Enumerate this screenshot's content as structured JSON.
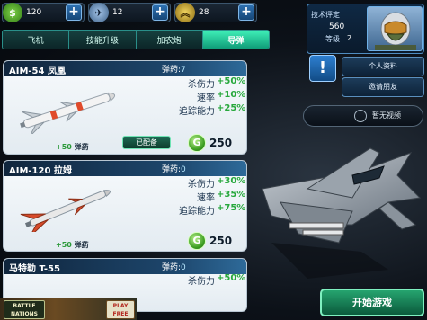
{
  "resources": {
    "gold": "120",
    "wings": "12",
    "rank": "28"
  },
  "tabs": [
    "飞机",
    "技能升级",
    "加农炮",
    "导弹"
  ],
  "active_tab": "导弹",
  "weapons": [
    {
      "name": "AIM-54 凤凰",
      "ammo_label": "弹药:",
      "ammo": "7",
      "stats": [
        {
          "label": "杀伤力",
          "value": "+50%"
        },
        {
          "label": "速率",
          "value": "+10%"
        },
        {
          "label": "追踪能力",
          "value": "+25%"
        }
      ],
      "buy_ammo": "+50",
      "buy_ammo_label": "弹药",
      "status": "已配备",
      "price": "250"
    },
    {
      "name": "AIM-120 拉姆",
      "ammo_label": "弹药:",
      "ammo": "0",
      "stats": [
        {
          "label": "杀伤力",
          "value": "+30%"
        },
        {
          "label": "速率",
          "value": "+35%"
        },
        {
          "label": "追踪能力",
          "value": "+75%"
        }
      ],
      "buy_ammo": "+50",
      "buy_ammo_label": "弹药",
      "price": "250"
    },
    {
      "name": "马特勒 T-55",
      "ammo_label": "弹药:",
      "ammo": "0",
      "stats": [
        {
          "label": "杀伤力",
          "value": "+50%"
        }
      ]
    }
  ],
  "profile": {
    "skill_label": "技术评定",
    "score": "560",
    "level_label": "等级",
    "level": "2"
  },
  "buttons": {
    "alert": "!",
    "personal_info": "个人资料",
    "invite_friends": "邀请朋友",
    "no_video": "暂无视频",
    "start_game": "开始游戏"
  },
  "ad": {
    "logo_line1": "BATTLE",
    "logo_line2": "NATIONS",
    "play_line1": "PLAY",
    "play_line2": "FREE"
  },
  "colors": {
    "stat_green": "#27a83c",
    "active_tab": "#3ff0b8",
    "header_blue": "#1d466c"
  }
}
